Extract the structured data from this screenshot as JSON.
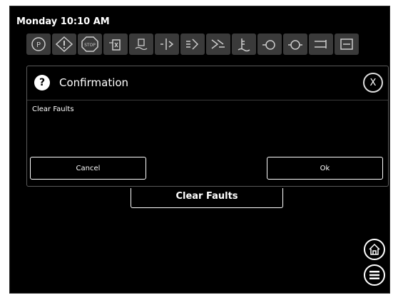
{
  "header": {
    "datetime": "Monday 10:10 AM"
  },
  "status_icons": [
    "park-brake-icon",
    "warning-icon",
    "stop-icon",
    "engine-fuel-icon",
    "water-in-fuel-icon",
    "coolant-icon",
    "transmission-icon",
    "regen-icon",
    "coolant-level-icon",
    "oil-pressure-icon",
    "oil-level-icon",
    "glow-plug-icon",
    "fuel-filter-icon"
  ],
  "dialog": {
    "title": "Confirmation",
    "close_label": "X",
    "message": "Clear Faults",
    "cancel_label": "Cancel",
    "ok_label": "Ok"
  },
  "page": {
    "section_label": "Clear Faults"
  },
  "nav": {
    "home_icon": "home-icon",
    "menu_icon": "menu-icon"
  }
}
